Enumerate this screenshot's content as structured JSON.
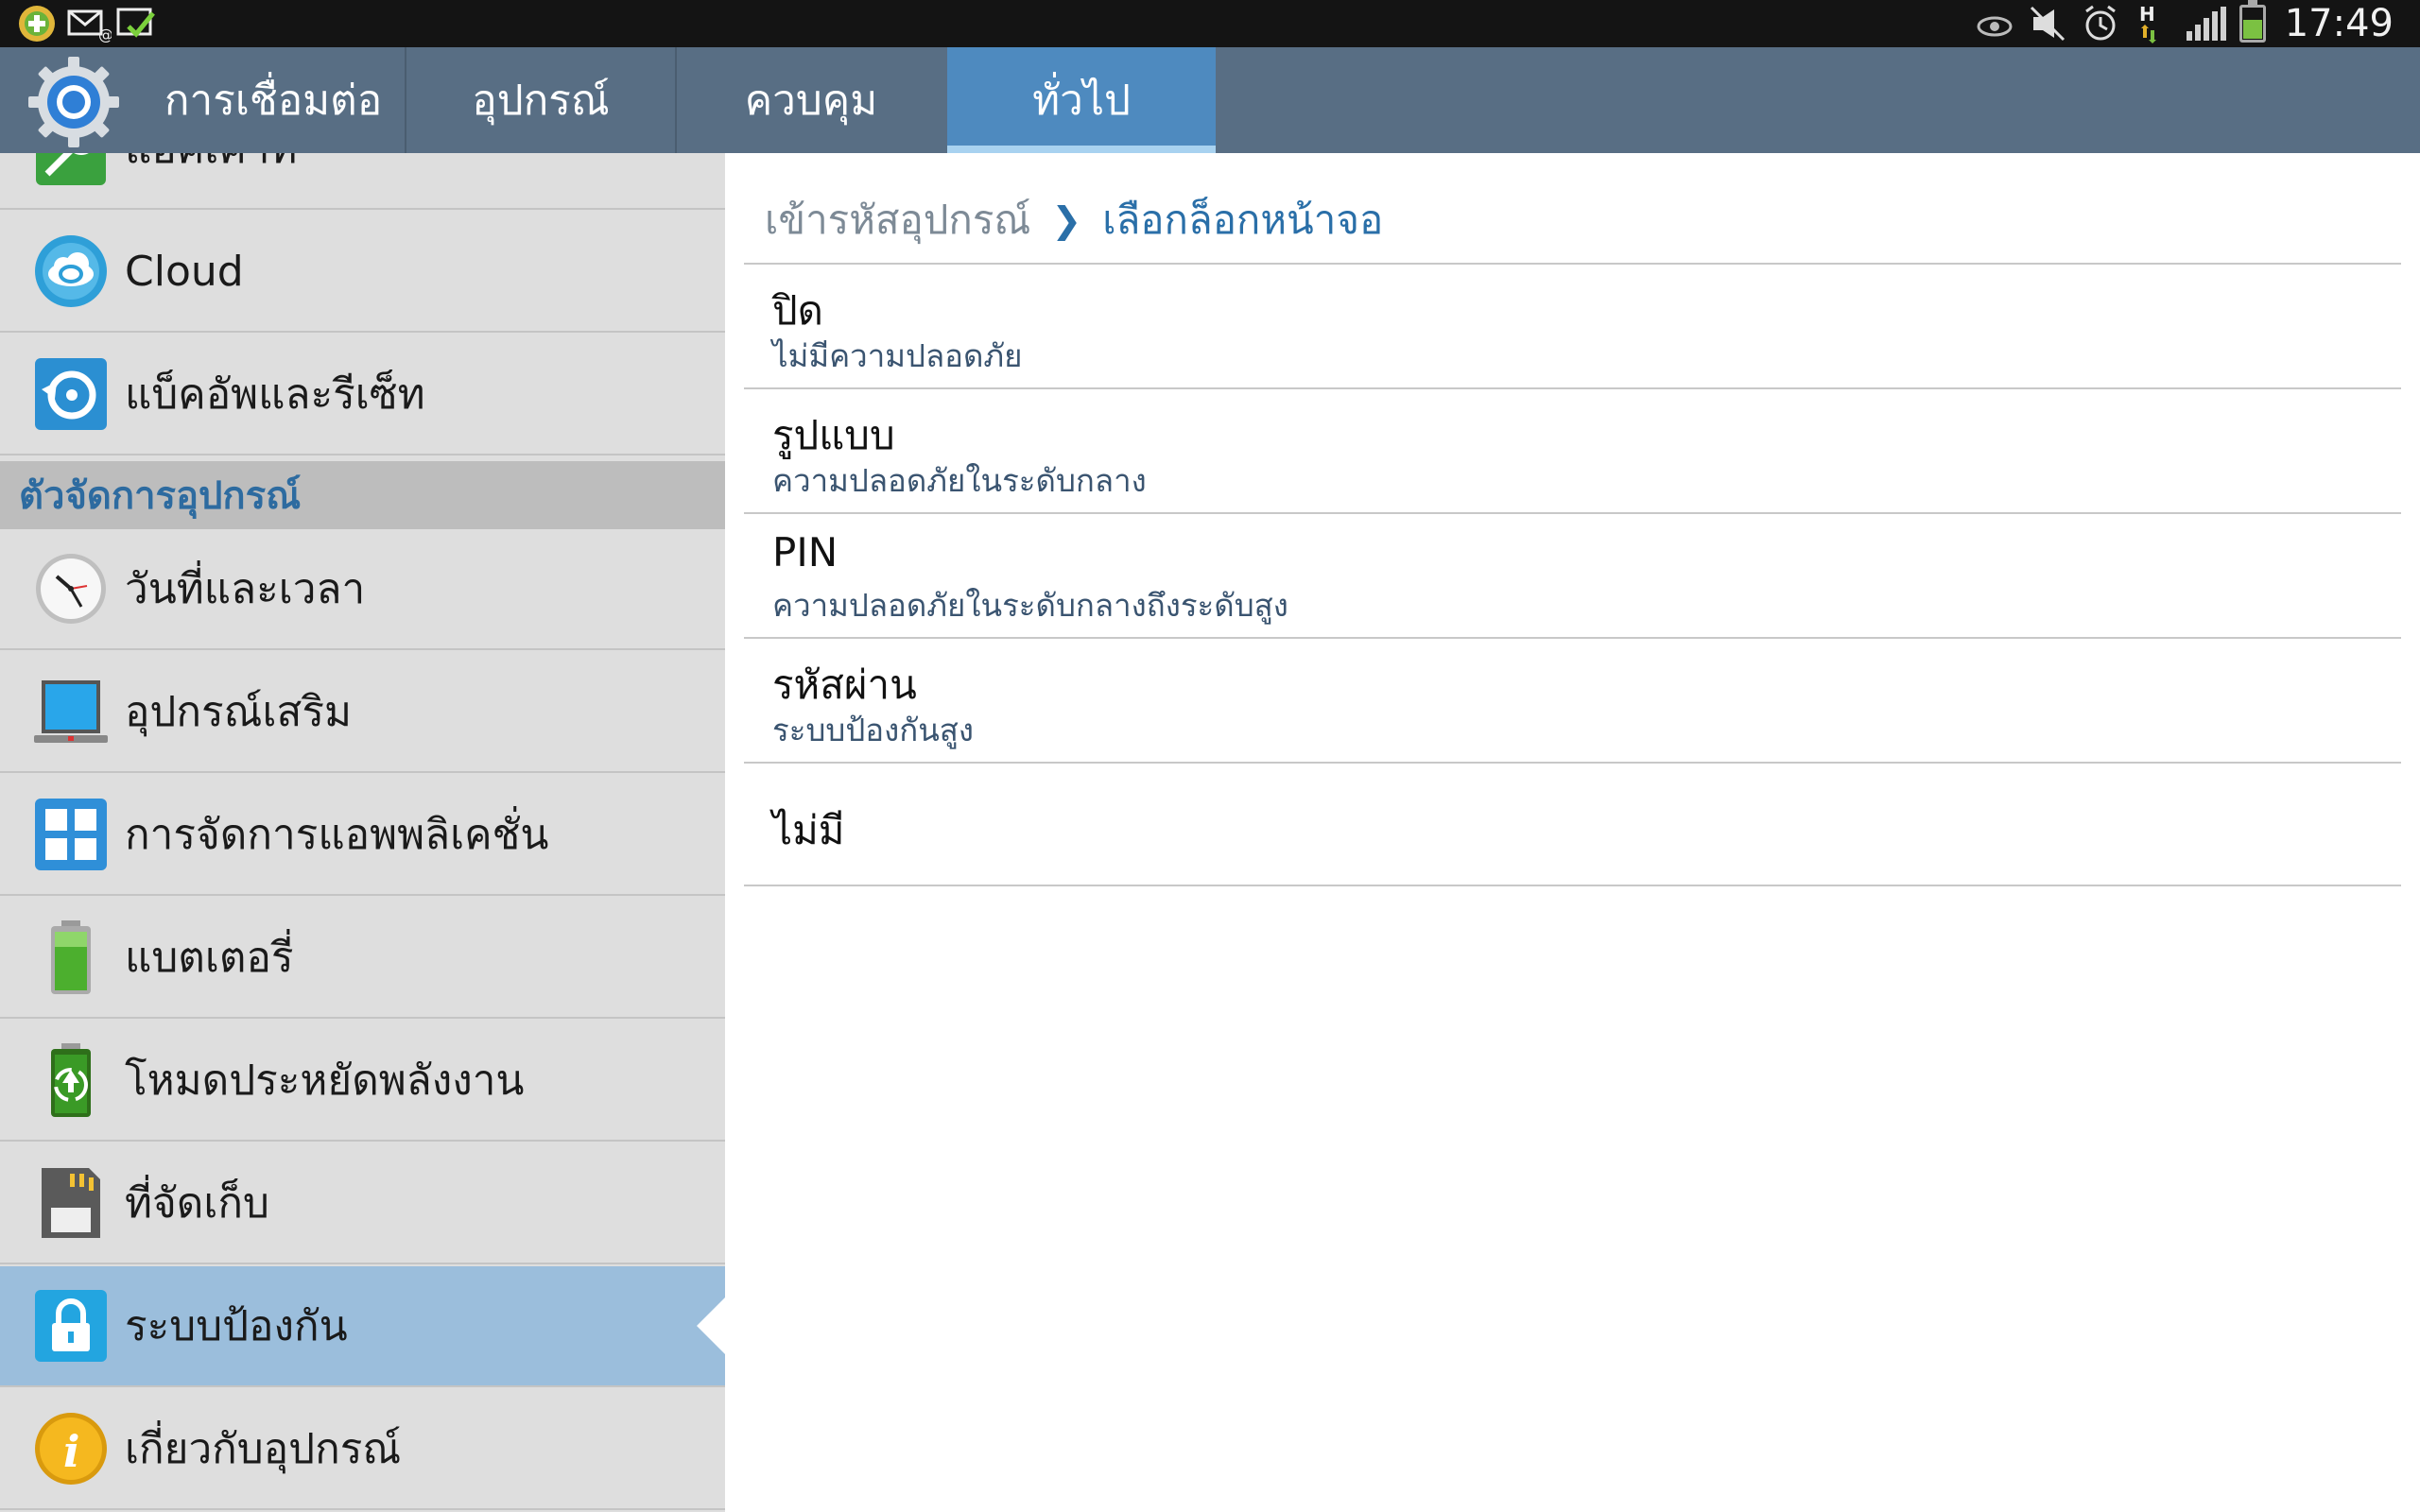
{
  "status_bar": {
    "time": "17:49",
    "network_type": "H",
    "left_icons": [
      "app-notification-icon",
      "email-icon",
      "download-complete-icon"
    ],
    "right_icons": [
      "smart-stay-eye-icon",
      "mute-icon",
      "alarm-icon",
      "network-h-icon",
      "signal-icon",
      "battery-icon"
    ]
  },
  "tabs": [
    {
      "label": "การเชื่อมต่อ"
    },
    {
      "label": "อุปกรณ์"
    },
    {
      "label": "ควบคุม"
    },
    {
      "label": "ทั่วไป"
    }
  ],
  "sidebar": {
    "items": [
      {
        "label": "แอคเคาท์",
        "icon": "accounts-icon"
      },
      {
        "label": "Cloud",
        "icon": "cloud-icon"
      },
      {
        "label": "แบ็คอัพและรีเซ็ท",
        "icon": "backup-reset-icon"
      },
      {
        "label": "วันที่และเวลา",
        "icon": "clock-icon"
      },
      {
        "label": "อุปกรณ์เสริม",
        "icon": "accessory-icon"
      },
      {
        "label": "การจัดการแอพพลิเคชั่น",
        "icon": "app-manager-icon"
      },
      {
        "label": "แบตเตอรี่",
        "icon": "battery-icon"
      },
      {
        "label": "โหมดประหยัดพลังงาน",
        "icon": "power-saving-icon"
      },
      {
        "label": "ที่จัดเก็บ",
        "icon": "storage-icon"
      },
      {
        "label": "ระบบป้องกัน",
        "icon": "lock-icon"
      },
      {
        "label": "เกี่ยวกับอุปกรณ์",
        "icon": "info-icon"
      }
    ],
    "section_header": "ตัวจัดการอุปกรณ์",
    "selected_item": "ระบบป้องกัน"
  },
  "main": {
    "breadcrumb": {
      "parent": "เข้ารหัสอุปกรณ์",
      "current": "เลือกล็อกหน้าจอ"
    },
    "options": [
      {
        "title": "ปิด",
        "subtitle": "ไม่มีความปลอดภัย"
      },
      {
        "title": "รูปแบบ",
        "subtitle": "ความปลอดภัยในระดับกลาง"
      },
      {
        "title": "PIN",
        "subtitle": "ความปลอดภัยในระดับกลางถึงระดับสูง"
      },
      {
        "title": "รหัสผ่าน",
        "subtitle": "ระบบป้องกันสูง"
      },
      {
        "title": "ไม่มี",
        "subtitle": ""
      }
    ]
  },
  "colors": {
    "tab_bar": "#586e84",
    "tab_active": "#4e8abf",
    "sidebar_bg": "#dedede",
    "sidebar_selected": "#9bbedc",
    "accent_text": "#2a6fa8"
  }
}
